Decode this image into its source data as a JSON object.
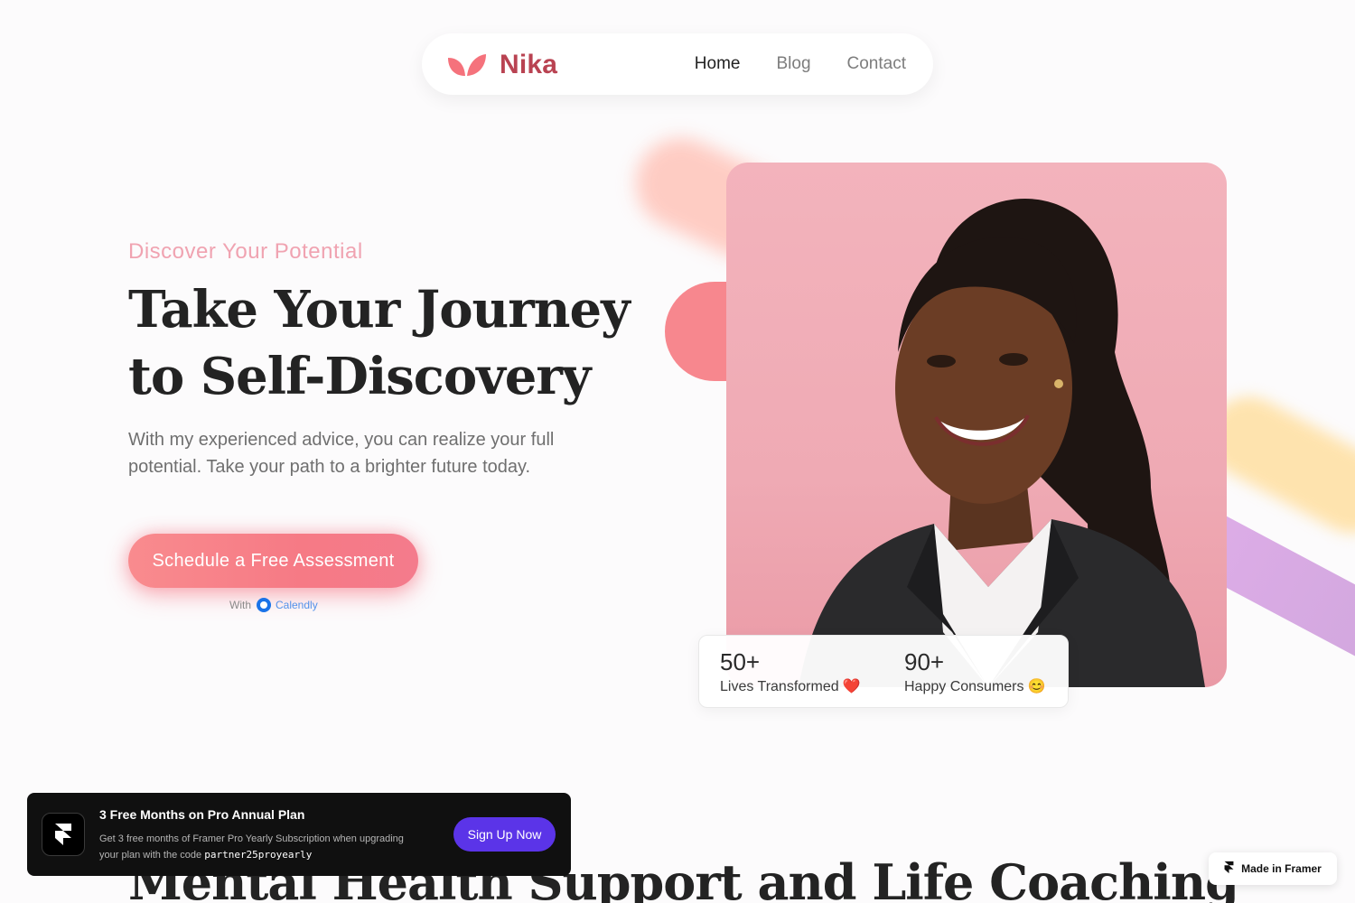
{
  "brand": {
    "name": "Nika",
    "logo_icon": "leaf-icon",
    "accent_color": "#f67a85",
    "logo_color": "#b94352"
  },
  "nav": {
    "items": [
      {
        "label": "Home",
        "active": true
      },
      {
        "label": "Blog",
        "active": false
      },
      {
        "label": "Contact",
        "active": false
      }
    ]
  },
  "hero": {
    "eyebrow": "Discover Your Potential",
    "title": "Take Your Journey to Self-Discovery",
    "subtitle": "With my experienced advice, you can realize your full potential. Take your path to a brighter future today.",
    "cta_label": "Schedule a Free Assessment",
    "cta_with": "With",
    "cta_provider": "Calendly"
  },
  "stats": [
    {
      "value": "50+",
      "label": "Lives Transformed",
      "emoji": "❤️"
    },
    {
      "value": "90+",
      "label": "Happy Consumers",
      "emoji": "😊"
    }
  ],
  "section": {
    "title": "Mental Health Support and Life Coaching"
  },
  "promo": {
    "title": "3 Free Months on Pro Annual Plan",
    "description": "Get 3 free months of Framer Pro Yearly Subscription when upgrading your plan with the code",
    "code": "partner25proyearly",
    "button_label": "Sign Up Now",
    "button_color": "#5b34e8"
  },
  "badge": {
    "label": "Made in Framer"
  }
}
